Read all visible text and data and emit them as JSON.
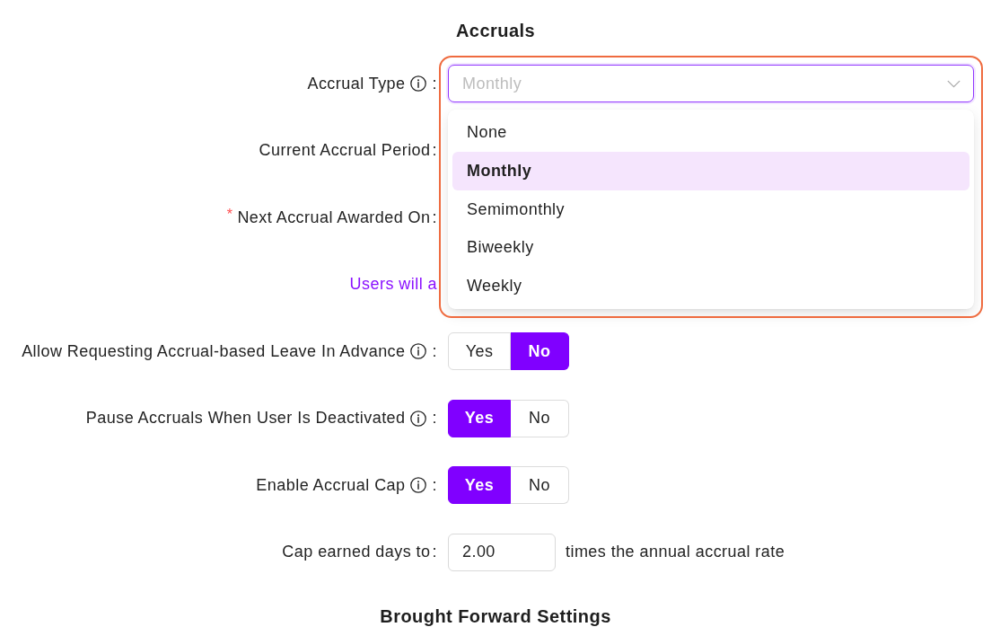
{
  "title": "Accruals",
  "rows": [
    {
      "kind": "select",
      "label": "Accrual Type",
      "info": true,
      "suffix": ":",
      "highlighted": true,
      "select": {
        "value": "Monthly",
        "open": true,
        "options": [
          {
            "label": "None",
            "selected": false
          },
          {
            "label": "Monthly",
            "selected": true
          },
          {
            "label": "Semimonthly",
            "selected": false
          },
          {
            "label": "Biweekly",
            "selected": false
          },
          {
            "label": "Weekly",
            "selected": false
          }
        ]
      }
    },
    {
      "kind": "covered",
      "label": "Current Accrual Period",
      "suffix": ":"
    },
    {
      "kind": "covered",
      "label": "Next Accrual Awarded On",
      "required_mark": "*",
      "suffix": ":"
    },
    {
      "kind": "note",
      "text": "Users will a"
    },
    {
      "kind": "toggle",
      "label": "Allow Requesting Accrual-based Leave In Advance",
      "info": true,
      "suffix": ":",
      "options": [
        {
          "label": "Yes",
          "selected": false
        },
        {
          "label": "No",
          "selected": true
        }
      ]
    },
    {
      "kind": "toggle",
      "label": "Pause Accruals When User Is Deactivated",
      "info": true,
      "suffix": ":",
      "options": [
        {
          "label": "Yes",
          "selected": true
        },
        {
          "label": "No",
          "selected": false
        }
      ]
    },
    {
      "kind": "toggle",
      "label": "Enable Accrual Cap",
      "info": true,
      "suffix": ":",
      "options": [
        {
          "label": "Yes",
          "selected": true
        },
        {
          "label": "No",
          "selected": false
        }
      ]
    },
    {
      "kind": "number",
      "label": "Cap earned days to",
      "suffix": ":",
      "value": "2.00",
      "unit": "times the annual accrual rate"
    }
  ],
  "next_section": "Brought Forward Settings"
}
